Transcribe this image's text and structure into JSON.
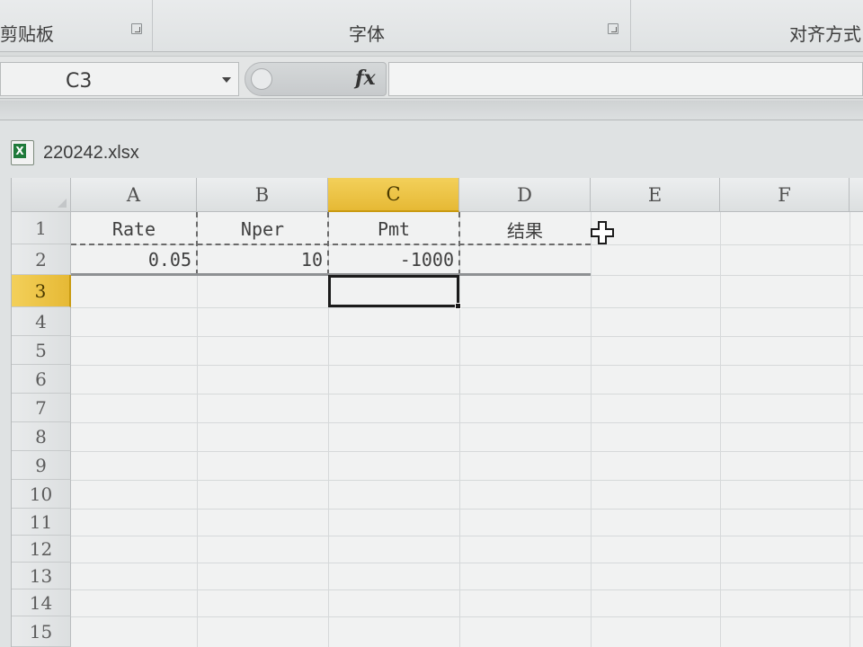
{
  "ribbon": {
    "groups": [
      {
        "label": "剪贴板"
      },
      {
        "label": "字体"
      },
      {
        "label": "对齐方式"
      }
    ]
  },
  "formula_bar": {
    "name_box": "C3",
    "fx_label": "fx",
    "formula": ""
  },
  "workbook": {
    "file_name": "220242.xlsx"
  },
  "sheet": {
    "columns": [
      "A",
      "B",
      "C",
      "D",
      "E",
      "F"
    ],
    "rows": [
      "1",
      "2",
      "3",
      "4",
      "5",
      "6",
      "7",
      "8",
      "9",
      "10",
      "11",
      "12",
      "13",
      "14",
      "15"
    ],
    "active_cell": "C3",
    "active_column": "C",
    "active_row": "3",
    "cells": {
      "A1": "Rate",
      "B1": "Nper",
      "C1": "Pmt",
      "D1": "结果",
      "A2": "0.05",
      "B2": "10",
      "C2": "-1000"
    }
  },
  "colors": {
    "active_header": "#e6b935",
    "grid_line": "#d6d9da",
    "selection_border": "#1b1b1b",
    "excel_green": "#1f7a3a"
  },
  "icons": {
    "workbook_icon": "excel-file-icon",
    "cursor": "cross-cursor-icon"
  }
}
